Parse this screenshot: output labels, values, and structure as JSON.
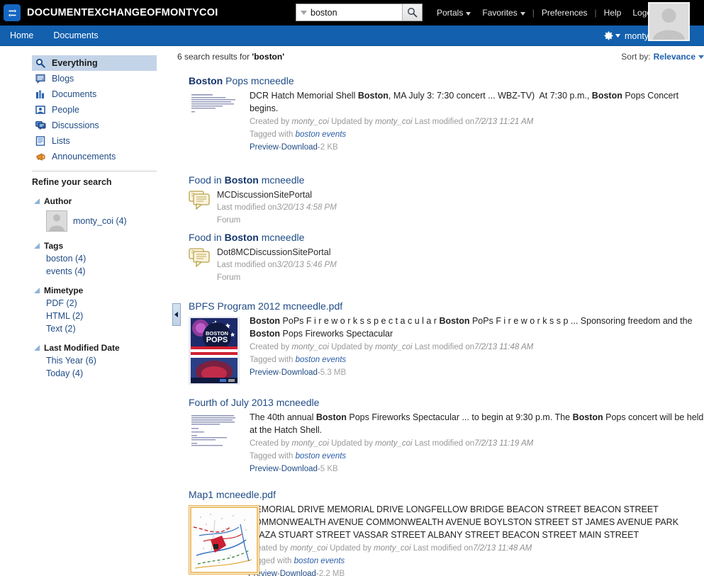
{
  "topbar": {
    "logo_icon": "exchange-arrows-icon",
    "brand": "DOCUMENTEXCHANGEOFMONTYCOI",
    "search": {
      "value": "boston",
      "placeholder": "",
      "dropdown_icon": "chevron-down-icon",
      "button_icon": "search-icon"
    },
    "links": [
      {
        "label": "Portals",
        "caret": true
      },
      {
        "label": "Favorites",
        "caret": true
      },
      {
        "label": "Preferences",
        "caret": false
      },
      {
        "label": "Help",
        "caret": false
      },
      {
        "label": "Logout",
        "caret": false
      }
    ],
    "avatar": "user-avatar"
  },
  "navbar": {
    "items": [
      {
        "label": "Home"
      },
      {
        "label": "Documents"
      }
    ],
    "gear_icon": "gear-icon",
    "gear_caret": "chevron-down-icon",
    "username": "monty_coi"
  },
  "sidebar": {
    "facets": [
      {
        "label": "Everything",
        "icon": "magnifier-icon",
        "selected": true
      },
      {
        "label": "Blogs",
        "icon": "blog-icon",
        "selected": false
      },
      {
        "label": "Documents",
        "icon": "documents-icon",
        "selected": false
      },
      {
        "label": "People",
        "icon": "person-card-icon",
        "selected": false
      },
      {
        "label": "Discussions",
        "icon": "discussions-icon",
        "selected": false
      },
      {
        "label": "Lists",
        "icon": "list-icon",
        "selected": false
      },
      {
        "label": "Announcements",
        "icon": "megaphone-icon",
        "selected": false
      }
    ],
    "refine_title": "Refine your search",
    "groups": [
      {
        "title": "Author",
        "type": "author",
        "items": [
          {
            "label": "monty_coi (4)",
            "avatar": "user-avatar"
          }
        ]
      },
      {
        "title": "Tags",
        "type": "links",
        "items": [
          {
            "label": "boston (4)"
          },
          {
            "label": "events (4)"
          }
        ]
      },
      {
        "title": "Mimetype",
        "type": "links",
        "items": [
          {
            "label": "PDF (2)"
          },
          {
            "label": "HTML (2)"
          },
          {
            "label": "Text (2)"
          }
        ]
      },
      {
        "title": "Last Modified Date",
        "type": "links",
        "items": [
          {
            "label": "This Year (6)"
          },
          {
            "label": "Today (4)"
          }
        ]
      }
    ],
    "collapse_icon": "collapse-left-icon"
  },
  "results_header": {
    "count_prefix": "6 search results for ",
    "query": "'boston'",
    "sort_label": "Sort by:",
    "sort_value": "Relevance",
    "sort_caret": "chevron-down-icon"
  },
  "results": [
    {
      "kind": "document",
      "title_pre": "Boston",
      "title_post": " Pops mcneedle",
      "thumb": "text-document-thumbnail",
      "snippet_parts": [
        {
          "t": "DCR Hatch Memorial Shell ",
          "b": false
        },
        {
          "t": "Boston",
          "b": true
        },
        {
          "t": ", MA July 3: 7:30 concert ... WBZ-TV)  At 7:30 p.m., ",
          "b": false
        },
        {
          "t": "Boston",
          "b": true
        },
        {
          "t": " Pops Concert begins.",
          "b": false
        }
      ],
      "created_by_label": "Created by",
      "created_by": "monty_coi",
      "updated_by_label": "Updated by",
      "updated_by": "monty_coi",
      "modified_label": "Last modified on",
      "modified": "7/2/13 11:21 AM",
      "tagged_label": "Tagged with",
      "tags": "boston events",
      "preview": "Preview",
      "download": "Download",
      "size": "2 KB"
    },
    {
      "kind": "forum",
      "title_pre": "Food in ",
      "title_bold": "Boston",
      "title_post": " mcneedle",
      "icon": "forum-icon",
      "site": "MCDiscussionSitePortal",
      "modified_label": "Last modified on",
      "modified": "3/20/13 4:58 PM",
      "type_label": "Forum"
    },
    {
      "kind": "forum",
      "title_pre": "Food in ",
      "title_bold": "Boston",
      "title_post": " mcneedle",
      "icon": "forum-icon",
      "site": "Dot8MCDiscussionSitePortal",
      "modified_label": "Last modified on",
      "modified": "3/20/13 5:46 PM",
      "type_label": "Forum"
    },
    {
      "kind": "document",
      "title_pre": "",
      "title_post": "BPFS Program 2012 mcneedle.pdf",
      "thumb": "boston-pops-poster-thumbnail",
      "snippet_parts": [
        {
          "t": "Boston",
          "b": true
        },
        {
          "t": " PoPs F i r e w o r k s s p e c t a c u l a r ",
          "b": false
        },
        {
          "t": "Boston",
          "b": true
        },
        {
          "t": " PoPs F i r e w o r k s s p ... Sponsoring freedom and the ",
          "b": false
        },
        {
          "t": "Boston",
          "b": true
        },
        {
          "t": " Pops Fireworks Spectacular",
          "b": false
        }
      ],
      "created_by_label": "Created by",
      "created_by": "monty_coi",
      "updated_by_label": "Updated by",
      "updated_by": "monty_coi",
      "modified_label": "Last modified on",
      "modified": "7/2/13 11:48 AM",
      "tagged_label": "Tagged with",
      "tags": "boston events",
      "preview": "Preview",
      "download": "Download",
      "size": "5.3 MB"
    },
    {
      "kind": "document",
      "title_pre": "",
      "title_post": "Fourth of July 2013 mcneedle",
      "thumb": "text-document-thumbnail",
      "snippet_parts": [
        {
          "t": "The 40th annual ",
          "b": false
        },
        {
          "t": "Boston",
          "b": true
        },
        {
          "t": " Pops Fireworks Spectacular ... to begin at 9:30 p.m. The ",
          "b": false
        },
        {
          "t": "Boston",
          "b": true
        },
        {
          "t": " Pops concert will be held at the Hatch Shell.",
          "b": false
        }
      ],
      "created_by_label": "Created by",
      "created_by": "monty_coi",
      "updated_by_label": "Updated by",
      "updated_by": "monty_coi",
      "modified_label": "Last modified on",
      "modified": "7/2/13 11:19 AM",
      "tagged_label": "Tagged with",
      "tags": "boston events",
      "preview": "Preview",
      "download": "Download",
      "size": "5 KB"
    },
    {
      "kind": "document",
      "title_pre": "",
      "title_post": "Map1 mcneedle.pdf",
      "thumb": "map-thumbnail",
      "snippet_parts": [
        {
          "t": "MEMORIAL DRIVE MEMORIAL DRIVE LONGFELLOW BRIDGE BEACON STREET BEACON STREET COMMONWEALTH AVENUE COMMONWEALTH AVENUE BOYLSTON STREET ST JAMES AVENUE PARK PLAZA STUART STREET VASSAR STREET ALBANY STREET BEACON STREET MAIN STREET",
          "b": false
        }
      ],
      "created_by_label": "Created by",
      "created_by": "monty_coi",
      "updated_by_label": "Updated by",
      "updated_by": "monty_coi",
      "modified_label": "Last modified on",
      "modified": "7/2/13 11:48 AM",
      "tagged_label": "Tagged with",
      "tags": "boston events",
      "preview": "Preview",
      "download": "Download",
      "size": "2.2 MB"
    }
  ],
  "colors": {
    "topbar_bg": "#000000",
    "nav_bg": "#1260ae",
    "link": "#1f4b86",
    "selected_facet_bg": "#c3d4e8",
    "meta_gray": "#9a9a9a"
  }
}
